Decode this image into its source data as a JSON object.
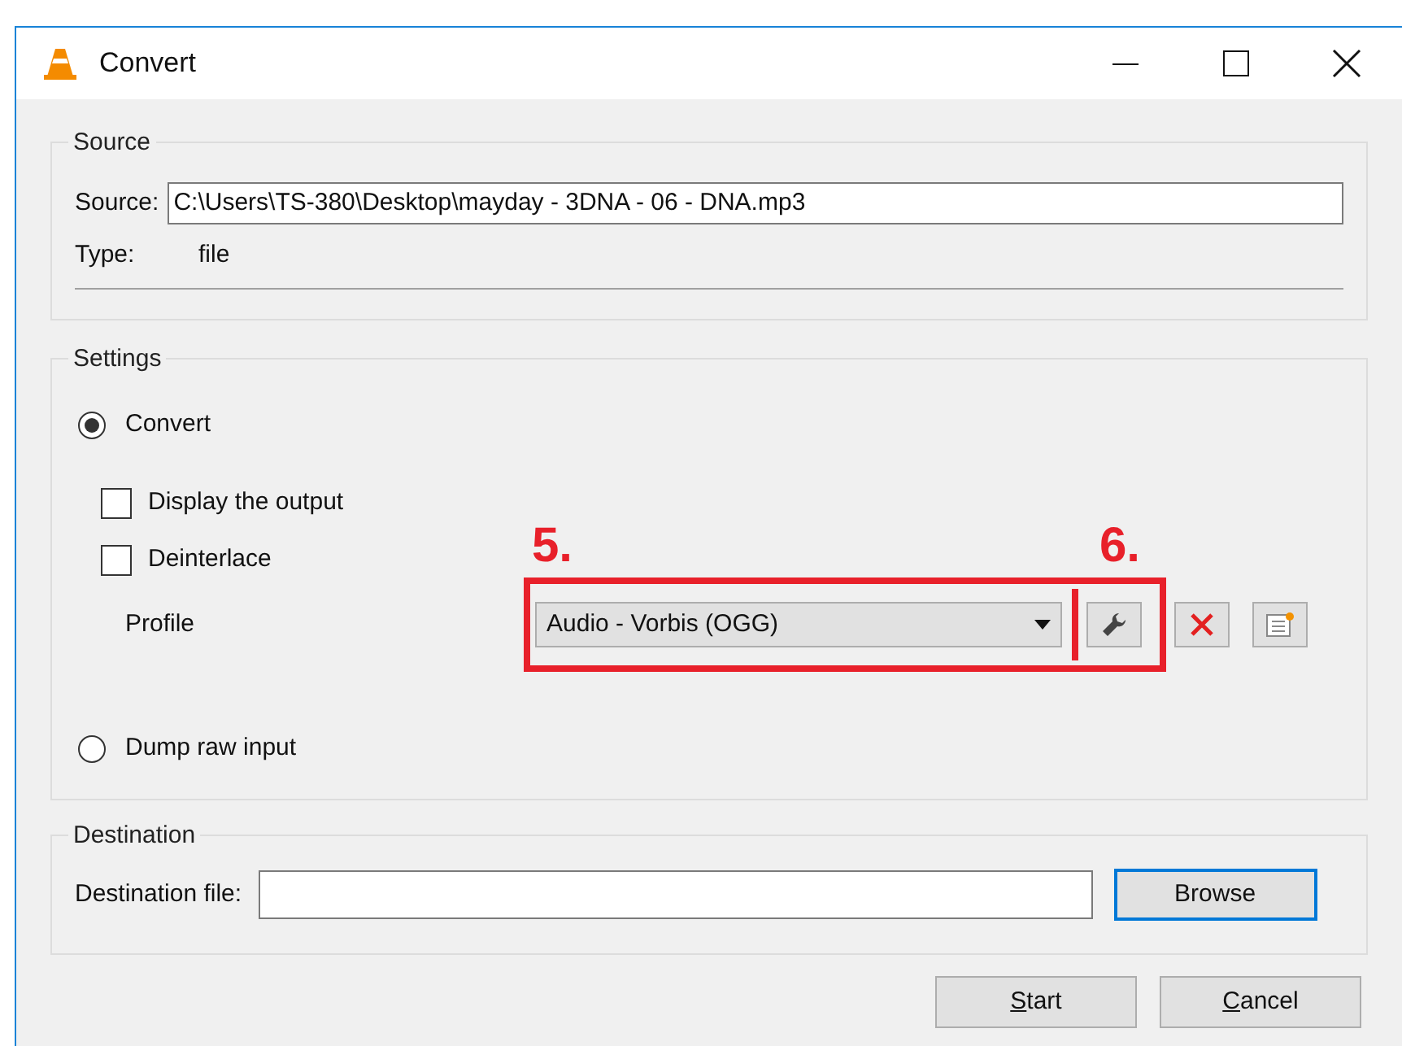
{
  "window": {
    "title": "Convert"
  },
  "source": {
    "legend": "Source",
    "source_label": "Source:",
    "source_value": "C:\\Users\\TS-380\\Desktop\\mayday - 3DNA - 06 - DNA.mp3",
    "type_label": "Type:",
    "type_value": "file"
  },
  "settings": {
    "legend": "Settings",
    "options": [
      {
        "kind": "radio",
        "label": "Convert",
        "selected": true
      },
      {
        "kind": "checkbox",
        "label": "Display the output",
        "checked": false
      },
      {
        "kind": "checkbox",
        "label": "Deinterlace",
        "checked": false
      }
    ],
    "profile": {
      "label": "Profile",
      "value": "Audio - Vorbis (OGG)",
      "annotation_dropdown": "5.",
      "annotation_edit": "6."
    },
    "dump": {
      "label": "Dump raw input",
      "selected": false
    }
  },
  "destination": {
    "legend": "Destination",
    "label": "Destination file:",
    "browse": "Browse"
  },
  "buttons": [
    "Start",
    "Cancel"
  ]
}
